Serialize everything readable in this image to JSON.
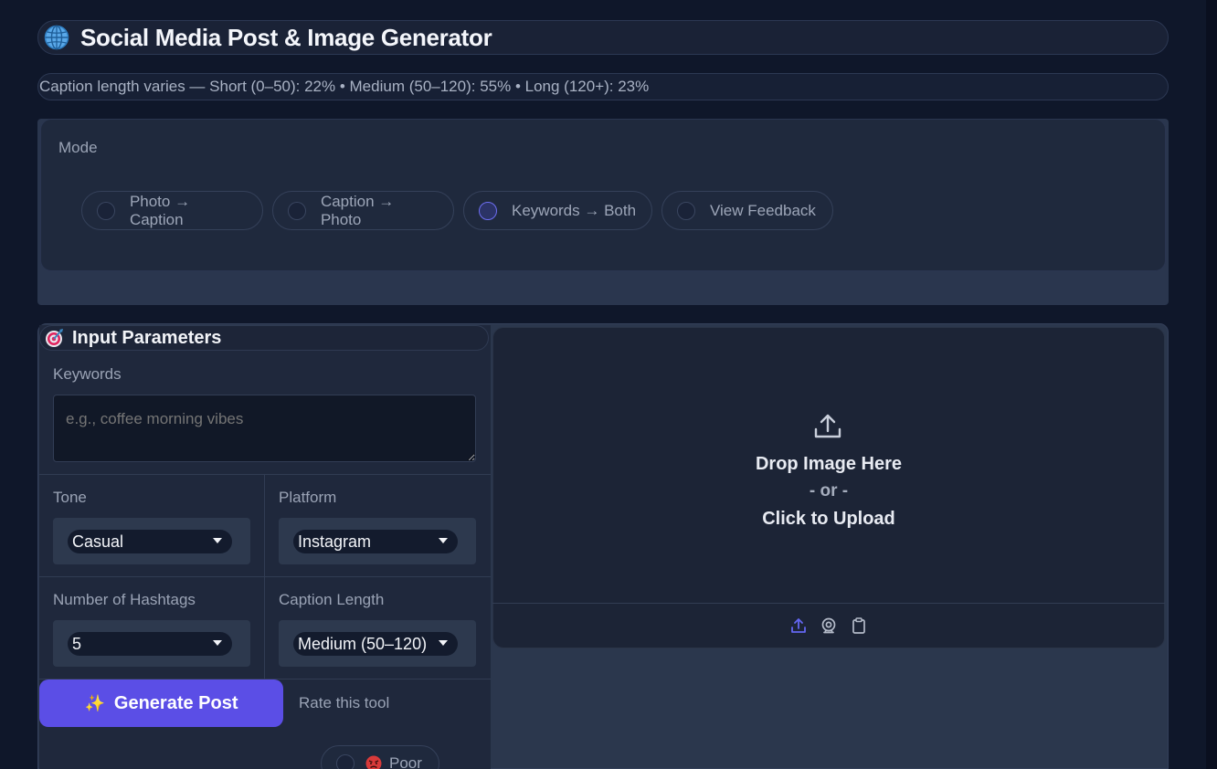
{
  "app": {
    "title": "Social Media Post & Image Generator",
    "title_icon": "globe-icon",
    "stats_text": "Caption length varies — Short (0–50): 22% • Medium (50–120): 55% • Long (120+): 23%"
  },
  "mode": {
    "label": "Mode",
    "options": [
      {
        "label": "Photo → Caption",
        "selected": false
      },
      {
        "label": "Caption → Photo",
        "selected": false
      },
      {
        "label": "Keywords → Both",
        "selected": true
      },
      {
        "label": "View Feedback",
        "selected": false
      }
    ]
  },
  "params": {
    "header": "Input Parameters",
    "header_icon": "target-icon",
    "keywords_label": "Keywords",
    "keywords_placeholder": "e.g., coffee morning vibes",
    "keywords_value": "",
    "tone_label": "Tone",
    "tone_value": "Casual",
    "platform_label": "Platform",
    "platform_value": "Instagram",
    "hashtags_label": "Number of Hashtags",
    "hashtags_value": "5",
    "caption_length_label": "Caption Length",
    "caption_length_value": "Medium (50–120)"
  },
  "actions": {
    "generate_label": "Generate Post",
    "generate_icon": "sparkles-icon"
  },
  "rating": {
    "label": "Rate this tool",
    "first_option": "Poor",
    "first_option_icon": "angry-face-icon"
  },
  "upload": {
    "drop_text": "Drop Image Here",
    "or_text": "- or -",
    "click_text": "Click to Upload",
    "toolbar_icons": [
      "upload-icon",
      "webcam-icon",
      "clipboard-icon"
    ],
    "accent_color": "#6366f1"
  },
  "colors": {
    "primary_button": "#5b4ee6",
    "panel": "#1f283c",
    "background": "#0f172a"
  }
}
